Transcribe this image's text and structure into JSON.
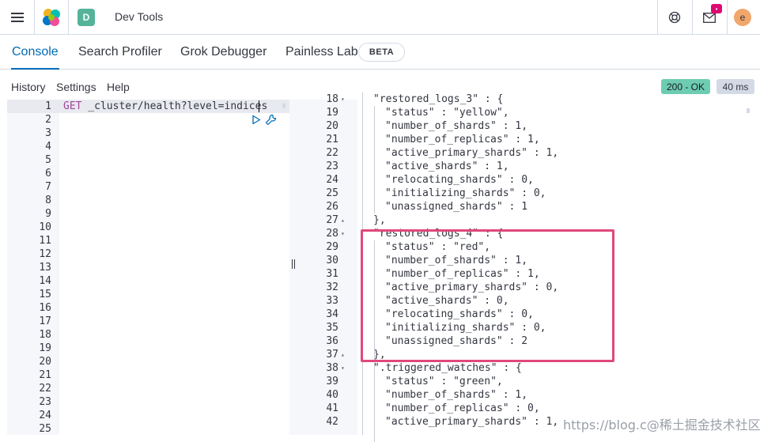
{
  "header": {
    "app_badge": "D",
    "app_title": "Dev Tools",
    "notification_badge": "•",
    "user_initial": "e"
  },
  "tabs": [
    {
      "label": "Console",
      "active": true
    },
    {
      "label": "Search Profiler",
      "active": false
    },
    {
      "label": "Grok Debugger",
      "active": false
    },
    {
      "label": "Painless Lab",
      "active": false,
      "badge": "BETA"
    }
  ],
  "menu": {
    "items": [
      "History",
      "Settings",
      "Help"
    ]
  },
  "status": {
    "code": "200 - OK",
    "time": "40 ms"
  },
  "request": {
    "method": "GET",
    "path": " _cluster/health?level=indices",
    "line_numbers": [
      "1",
      "2",
      "3",
      "4",
      "5",
      "6",
      "7",
      "8",
      "9",
      "10",
      "11",
      "12",
      "13",
      "14",
      "15",
      "16",
      "17",
      "18",
      "19",
      "20",
      "21",
      "22",
      "23",
      "24",
      "25"
    ]
  },
  "response": {
    "lines": [
      {
        "n": "18",
        "text": "\"restored_logs_3\" : {",
        "indent": 1,
        "fold": "down"
      },
      {
        "n": "19",
        "text": "\"status\" : \"yellow\",",
        "indent": 2
      },
      {
        "n": "20",
        "text": "\"number_of_shards\" : 1,",
        "indent": 2
      },
      {
        "n": "21",
        "text": "\"number_of_replicas\" : 1,",
        "indent": 2
      },
      {
        "n": "22",
        "text": "\"active_primary_shards\" : 1,",
        "indent": 2
      },
      {
        "n": "23",
        "text": "\"active_shards\" : 1,",
        "indent": 2
      },
      {
        "n": "24",
        "text": "\"relocating_shards\" : 0,",
        "indent": 2
      },
      {
        "n": "25",
        "text": "\"initializing_shards\" : 0,",
        "indent": 2
      },
      {
        "n": "26",
        "text": "\"unassigned_shards\" : 1",
        "indent": 2
      },
      {
        "n": "27",
        "text": "},",
        "indent": 1,
        "fold": "up"
      },
      {
        "n": "28",
        "text": "\"restored_logs_4\" : {",
        "indent": 1,
        "fold": "down"
      },
      {
        "n": "29",
        "text": "\"status\" : \"red\",",
        "indent": 2
      },
      {
        "n": "30",
        "text": "\"number_of_shards\" : 1,",
        "indent": 2
      },
      {
        "n": "31",
        "text": "\"number_of_replicas\" : 1,",
        "indent": 2
      },
      {
        "n": "32",
        "text": "\"active_primary_shards\" : 0,",
        "indent": 2
      },
      {
        "n": "33",
        "text": "\"active_shards\" : 0,",
        "indent": 2
      },
      {
        "n": "34",
        "text": "\"relocating_shards\" : 0,",
        "indent": 2
      },
      {
        "n": "35",
        "text": "\"initializing_shards\" : 0,",
        "indent": 2
      },
      {
        "n": "36",
        "text": "\"unassigned_shards\" : 2",
        "indent": 2
      },
      {
        "n": "37",
        "text": "},",
        "indent": 1,
        "fold": "up"
      },
      {
        "n": "38",
        "text": "\".triggered_watches\" : {",
        "indent": 1,
        "fold": "down"
      },
      {
        "n": "39",
        "text": "\"status\" : \"green\",",
        "indent": 2
      },
      {
        "n": "40",
        "text": "\"number_of_shards\" : 1,",
        "indent": 2
      },
      {
        "n": "41",
        "text": "\"number_of_replicas\" : 0,",
        "indent": 2
      },
      {
        "n": "42",
        "text": "\"active_primary_shards\" : 1,",
        "indent": 2
      }
    ]
  },
  "watermark": "https://blog.c@稀土掘金技术社区",
  "colors": {
    "accent": "#006bb8",
    "ok": "#6dccb1",
    "method": "#a2469b",
    "json_key": "#343741",
    "highlight_box": "#e0487b"
  }
}
